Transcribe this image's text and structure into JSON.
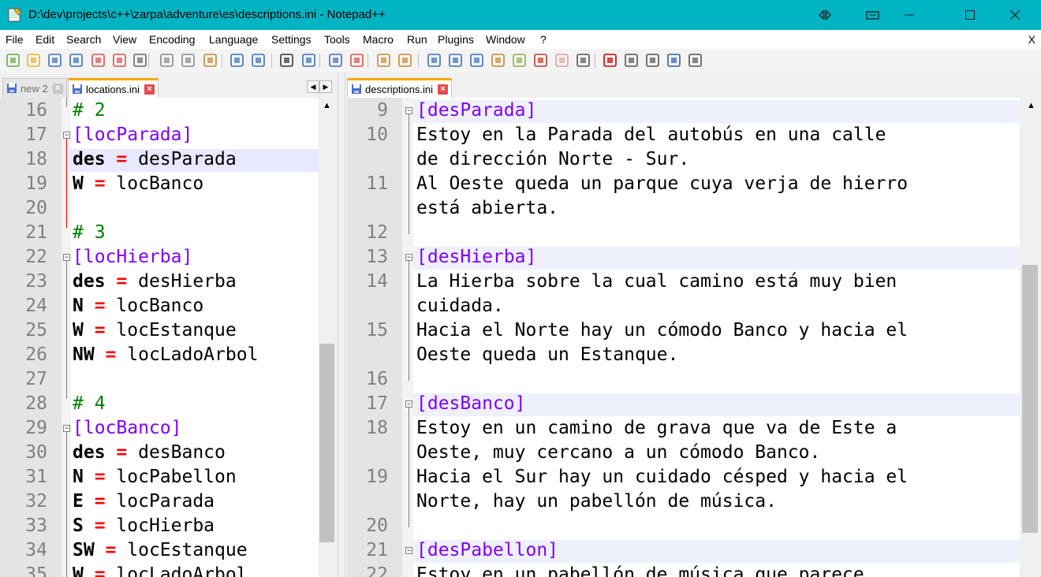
{
  "window": {
    "title": "D:\\dev\\projects\\c++\\zarpa\\adventure\\es\\descriptions.ini - Notepad++",
    "close_menu_label": "X"
  },
  "menu": [
    "File",
    "Edit",
    "Search",
    "View",
    "Encoding",
    "Language",
    "Settings",
    "Tools",
    "Macro",
    "Run",
    "Plugins",
    "Window",
    "?"
  ],
  "toolbar_icons": [
    "new-file-icon",
    "open-file-icon",
    "save-icon",
    "save-all-icon",
    "close-icon",
    "close-all-icon",
    "print-icon",
    "cut-icon",
    "copy-icon",
    "paste-icon",
    "undo-icon",
    "redo-icon",
    "find-icon",
    "replace-icon",
    "zoom-in-icon",
    "zoom-out-icon",
    "sync-vertical-icon",
    "sync-horizontal-icon",
    "word-wrap-icon",
    "show-all-chars-icon",
    "indent-guide-icon",
    "user-language-icon",
    "doc-map-icon",
    "function-list-icon",
    "folder-workspace-icon",
    "monitoring-icon",
    "record-macro-icon",
    "stop-macro-icon",
    "play-macro-icon",
    "run-macro-multiple-icon",
    "save-macro-icon"
  ],
  "left_tabs": [
    {
      "label": "new 2",
      "active": false
    },
    {
      "label": "locations.ini",
      "active": true
    }
  ],
  "right_tabs": [
    {
      "label": "descriptions.ini",
      "active": true
    }
  ],
  "left_editor": {
    "lines": [
      {
        "n": "16",
        "tokens": [
          {
            "t": "cmt",
            "v": "# 2"
          }
        ]
      },
      {
        "n": "17",
        "tokens": [
          {
            "t": "sec",
            "v": "[locParada]"
          }
        ]
      },
      {
        "n": "18",
        "tokens": [
          {
            "t": "kw",
            "v": "des"
          },
          {
            "t": "eq",
            "v": " = "
          },
          {
            "t": "val",
            "v": "desParada"
          }
        ],
        "highlight": true
      },
      {
        "n": "19",
        "tokens": [
          {
            "t": "kw",
            "v": "W"
          },
          {
            "t": "eq",
            "v": " = "
          },
          {
            "t": "val",
            "v": "locBanco"
          }
        ]
      },
      {
        "n": "20",
        "tokens": []
      },
      {
        "n": "21",
        "tokens": [
          {
            "t": "cmt",
            "v": "# 3"
          }
        ]
      },
      {
        "n": "22",
        "tokens": [
          {
            "t": "sec",
            "v": "[locHierba]"
          }
        ]
      },
      {
        "n": "23",
        "tokens": [
          {
            "t": "kw",
            "v": "des"
          },
          {
            "t": "eq",
            "v": " = "
          },
          {
            "t": "val",
            "v": "desHierba"
          }
        ]
      },
      {
        "n": "24",
        "tokens": [
          {
            "t": "kw",
            "v": "N"
          },
          {
            "t": "eq",
            "v": " = "
          },
          {
            "t": "val",
            "v": "locBanco"
          }
        ]
      },
      {
        "n": "25",
        "tokens": [
          {
            "t": "kw",
            "v": "W"
          },
          {
            "t": "eq",
            "v": " = "
          },
          {
            "t": "val",
            "v": "locEstanque"
          }
        ]
      },
      {
        "n": "26",
        "tokens": [
          {
            "t": "kw",
            "v": "NW"
          },
          {
            "t": "eq",
            "v": " = "
          },
          {
            "t": "val",
            "v": "locLadoArbol"
          }
        ]
      },
      {
        "n": "27",
        "tokens": []
      },
      {
        "n": "28",
        "tokens": [
          {
            "t": "cmt",
            "v": "# 4"
          }
        ]
      },
      {
        "n": "29",
        "tokens": [
          {
            "t": "sec",
            "v": "[locBanco]"
          }
        ]
      },
      {
        "n": "30",
        "tokens": [
          {
            "t": "kw",
            "v": "des"
          },
          {
            "t": "eq",
            "v": " = "
          },
          {
            "t": "val",
            "v": "desBanco"
          }
        ]
      },
      {
        "n": "31",
        "tokens": [
          {
            "t": "kw",
            "v": "N"
          },
          {
            "t": "eq",
            "v": " = "
          },
          {
            "t": "val",
            "v": "locPabellon"
          }
        ]
      },
      {
        "n": "32",
        "tokens": [
          {
            "t": "kw",
            "v": "E"
          },
          {
            "t": "eq",
            "v": " = "
          },
          {
            "t": "val",
            "v": "locParada"
          }
        ]
      },
      {
        "n": "33",
        "tokens": [
          {
            "t": "kw",
            "v": "S"
          },
          {
            "t": "eq",
            "v": " = "
          },
          {
            "t": "val",
            "v": "locHierba"
          }
        ]
      },
      {
        "n": "34",
        "tokens": [
          {
            "t": "kw",
            "v": "SW"
          },
          {
            "t": "eq",
            "v": " = "
          },
          {
            "t": "val",
            "v": "locEstanque"
          }
        ]
      },
      {
        "n": "35",
        "tokens": [
          {
            "t": "kw",
            "v": "W"
          },
          {
            "t": "eq",
            "v": " = "
          },
          {
            "t": "val",
            "v": "locLadoArbol"
          }
        ]
      }
    ]
  },
  "right_editor": {
    "lines": [
      {
        "n": "9",
        "tokens": [
          {
            "t": "sec",
            "v": "[desParada]"
          }
        ],
        "section": true
      },
      {
        "n": "10",
        "tokens": [
          {
            "t": "val",
            "v": "Estoy en la Parada del autobús en una calle"
          }
        ]
      },
      {
        "n": "",
        "tokens": [
          {
            "t": "val",
            "v": "de dirección Norte - Sur."
          }
        ]
      },
      {
        "n": "11",
        "tokens": [
          {
            "t": "val",
            "v": "Al Oeste queda un parque cuya verja de hierro"
          }
        ]
      },
      {
        "n": "",
        "tokens": [
          {
            "t": "val",
            "v": "está abierta."
          }
        ]
      },
      {
        "n": "12",
        "tokens": []
      },
      {
        "n": "13",
        "tokens": [
          {
            "t": "sec",
            "v": "[desHierba]"
          }
        ],
        "section": true
      },
      {
        "n": "14",
        "tokens": [
          {
            "t": "val",
            "v": "La Hierba sobre la cual camino está muy bien"
          }
        ]
      },
      {
        "n": "",
        "tokens": [
          {
            "t": "val",
            "v": "cuidada."
          }
        ]
      },
      {
        "n": "15",
        "tokens": [
          {
            "t": "val",
            "v": "Hacia el Norte hay un cómodo Banco y hacia el"
          }
        ]
      },
      {
        "n": "",
        "tokens": [
          {
            "t": "val",
            "v": "Oeste queda un Estanque."
          }
        ]
      },
      {
        "n": "16",
        "tokens": []
      },
      {
        "n": "17",
        "tokens": [
          {
            "t": "sec",
            "v": "[desBanco]"
          }
        ],
        "section": true
      },
      {
        "n": "18",
        "tokens": [
          {
            "t": "val",
            "v": "Estoy en un camino de grava que va de Este a"
          }
        ]
      },
      {
        "n": "",
        "tokens": [
          {
            "t": "val",
            "v": "Oeste, muy cercano a un cómodo Banco."
          }
        ]
      },
      {
        "n": "19",
        "tokens": [
          {
            "t": "val",
            "v": "Hacia el Sur hay un cuidado césped y hacia el"
          }
        ]
      },
      {
        "n": "",
        "tokens": [
          {
            "t": "val",
            "v": "Norte, hay un pabellón de música."
          }
        ]
      },
      {
        "n": "20",
        "tokens": []
      },
      {
        "n": "21",
        "tokens": [
          {
            "t": "sec",
            "v": "[desPabellon]"
          }
        ],
        "section": true
      },
      {
        "n": "22",
        "tokens": [
          {
            "t": "val",
            "v": "Estoy en un pabellón de música que parece"
          }
        ]
      }
    ]
  },
  "colors": {
    "titlebar": "#00b4c4",
    "section": "#8000ff",
    "operator": "#ff0000",
    "comment": "#008000",
    "active_tab_accent": "#f8a800"
  }
}
